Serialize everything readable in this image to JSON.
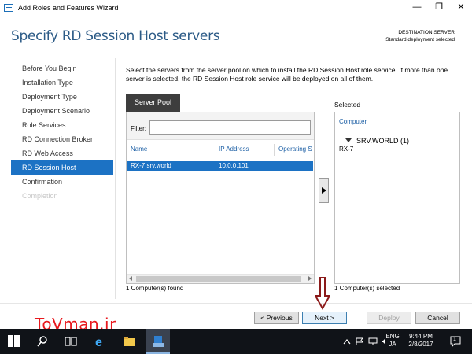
{
  "window": {
    "title": "Add Roles and Features Wizard",
    "controls": {
      "minimize": "—",
      "maximize": "❐",
      "close": "✕"
    }
  },
  "header": {
    "page_title": "Specify RD Session Host servers",
    "destination_label": "DESTINATION SERVER",
    "destination_value": "Standard deployment selected"
  },
  "nav": {
    "items": [
      {
        "label": "Before You Begin",
        "state": "normal"
      },
      {
        "label": "Installation Type",
        "state": "normal"
      },
      {
        "label": "Deployment Type",
        "state": "normal"
      },
      {
        "label": "Deployment Scenario",
        "state": "normal"
      },
      {
        "label": "Role Services",
        "state": "normal"
      },
      {
        "label": "RD Connection Broker",
        "state": "normal"
      },
      {
        "label": "RD Web Access",
        "state": "normal"
      },
      {
        "label": "RD Session Host",
        "state": "active"
      },
      {
        "label": "Confirmation",
        "state": "normal"
      },
      {
        "label": "Completion",
        "state": "disabled"
      }
    ]
  },
  "main": {
    "description": "Select the servers from the server pool on which to install the RD Session Host role service. If more than one server is selected, the RD Session Host role service will be deployed on all of them.",
    "server_pool": {
      "tab_label": "Server Pool",
      "filter_label": "Filter:",
      "filter_value": "",
      "columns": [
        "Name",
        "IP Address",
        "Operating S"
      ],
      "rows": [
        {
          "name": "RX-7.srv.world",
          "ip": "10.0.0.101",
          "os": ""
        }
      ],
      "found_text": "1 Computer(s) found"
    },
    "selected": {
      "label": "Selected",
      "column": "Computer",
      "group": "SRV.WORLD (1)",
      "items": [
        "RX-7"
      ],
      "count_text": "1 Computer(s) selected"
    }
  },
  "footer": {
    "previous": "< Previous",
    "next": "Next >",
    "deploy": "Deploy",
    "cancel": "Cancel"
  },
  "overlay": {
    "watermark": "ToVman.ir"
  },
  "taskbar": {
    "language_top": "ENG",
    "language_bottom": "JA",
    "time": "9:44 PM",
    "date": "2/8/2017",
    "notification_count": "1"
  },
  "colors": {
    "accent": "#1c72c4",
    "title_blue": "#2b5a86",
    "taskbar": "#101318",
    "watermark": "#e8181d",
    "arrow": "#8b1a1a"
  }
}
